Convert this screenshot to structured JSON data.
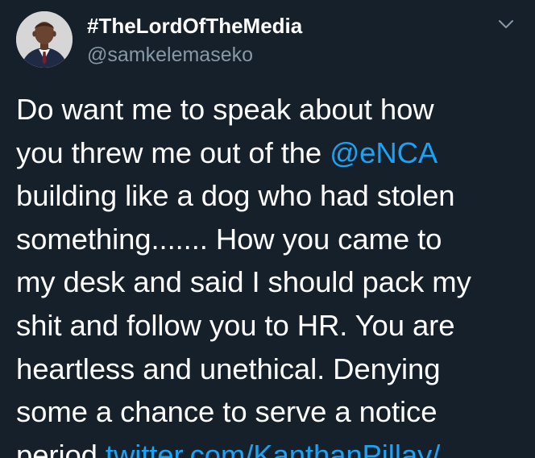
{
  "tweet": {
    "display_name": "#TheLordOfTheMedia",
    "handle": "@samkelemaseko",
    "text_part1": "Do want me to speak about how\nyou threw me out of the ",
    "mention": "@eNCA",
    "text_part2": "\n building like a dog who had stolen\nsomething....... How you came to\nmy desk and said I should pack my\nshit and follow you to HR. You are\nheartless and unethical. Denying\nsome a chance to serve a notice\nperiod ",
    "link": "twitter.com/KanthanPillay/…"
  },
  "icons": {
    "avatar": "profile-photo",
    "menu": "chevron-down-icon"
  },
  "colors": {
    "background": "#15202b",
    "text": "#ffffff",
    "secondary_text": "#8899a6",
    "accent": "#1da1f2"
  }
}
